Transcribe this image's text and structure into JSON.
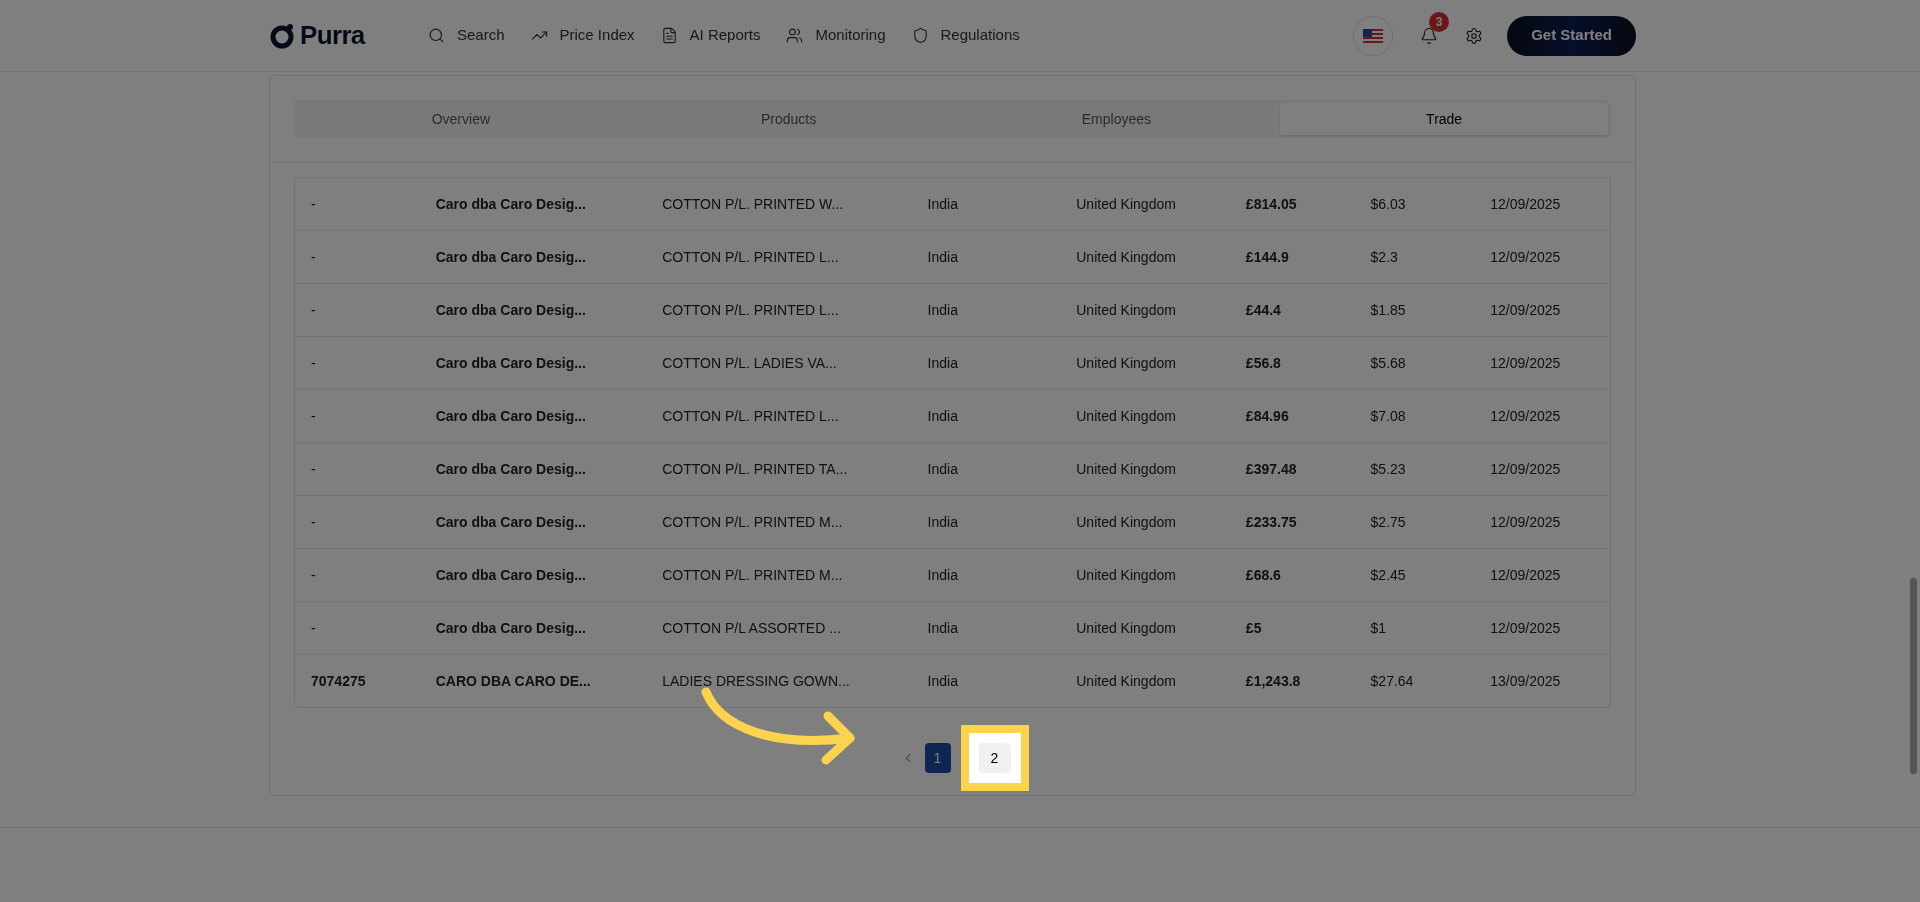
{
  "nav": {
    "logo": "Purra",
    "items": [
      {
        "label": "Search"
      },
      {
        "label": "Price Index"
      },
      {
        "label": "AI Reports"
      },
      {
        "label": "Monitoring"
      },
      {
        "label": "Regulations"
      }
    ],
    "notifications": "3",
    "cta": "Get Started"
  },
  "tabs": [
    {
      "label": "Overview",
      "selected": false
    },
    {
      "label": "Products",
      "selected": false
    },
    {
      "label": "Employees",
      "selected": false
    },
    {
      "label": "Trade",
      "selected": true
    }
  ],
  "table": {
    "rows": [
      [
        "-",
        "Caro dba Caro Desig...",
        "COTTON P/L. PRINTED W...",
        "India",
        "United Kingdom",
        "£814.05",
        "$6.03",
        "12/09/2025"
      ],
      [
        "-",
        "Caro dba Caro Desig...",
        "COTTON P/L. PRINTED L...",
        "India",
        "United Kingdom",
        "£144.9",
        "$2.3",
        "12/09/2025"
      ],
      [
        "-",
        "Caro dba Caro Desig...",
        "COTTON P/L. PRINTED L...",
        "India",
        "United Kingdom",
        "£44.4",
        "$1.85",
        "12/09/2025"
      ],
      [
        "-",
        "Caro dba Caro Desig...",
        "COTTON P/L. LADIES VA...",
        "India",
        "United Kingdom",
        "£56.8",
        "$5.68",
        "12/09/2025"
      ],
      [
        "-",
        "Caro dba Caro Desig...",
        "COTTON P/L. PRINTED L...",
        "India",
        "United Kingdom",
        "£84.96",
        "$7.08",
        "12/09/2025"
      ],
      [
        "-",
        "Caro dba Caro Desig...",
        "COTTON P/L. PRINTED TA...",
        "India",
        "United Kingdom",
        "£397.48",
        "$5.23",
        "12/09/2025"
      ],
      [
        "-",
        "Caro dba Caro Desig...",
        "COTTON P/L. PRINTED M...",
        "India",
        "United Kingdom",
        "£233.75",
        "$2.75",
        "12/09/2025"
      ],
      [
        "-",
        "Caro dba Caro Desig...",
        "COTTON P/L. PRINTED M...",
        "India",
        "United Kingdom",
        "£68.6",
        "$2.45",
        "12/09/2025"
      ],
      [
        "-",
        "Caro dba Caro Desig...",
        "COTTON P/L ASSORTED ...",
        "India",
        "United Kingdom",
        "£5",
        "$1",
        "12/09/2025"
      ],
      [
        "7074275",
        "CARO DBA CARO DE...",
        "LADIES DRESSING GOWN...",
        "India",
        "United Kingdom",
        "£1,243.8",
        "$27.64",
        "13/09/2025"
      ]
    ]
  },
  "pagination": {
    "pages": [
      {
        "label": "1",
        "selected": true
      },
      {
        "label": "2",
        "selected": false,
        "highlighted": true
      }
    ]
  }
}
